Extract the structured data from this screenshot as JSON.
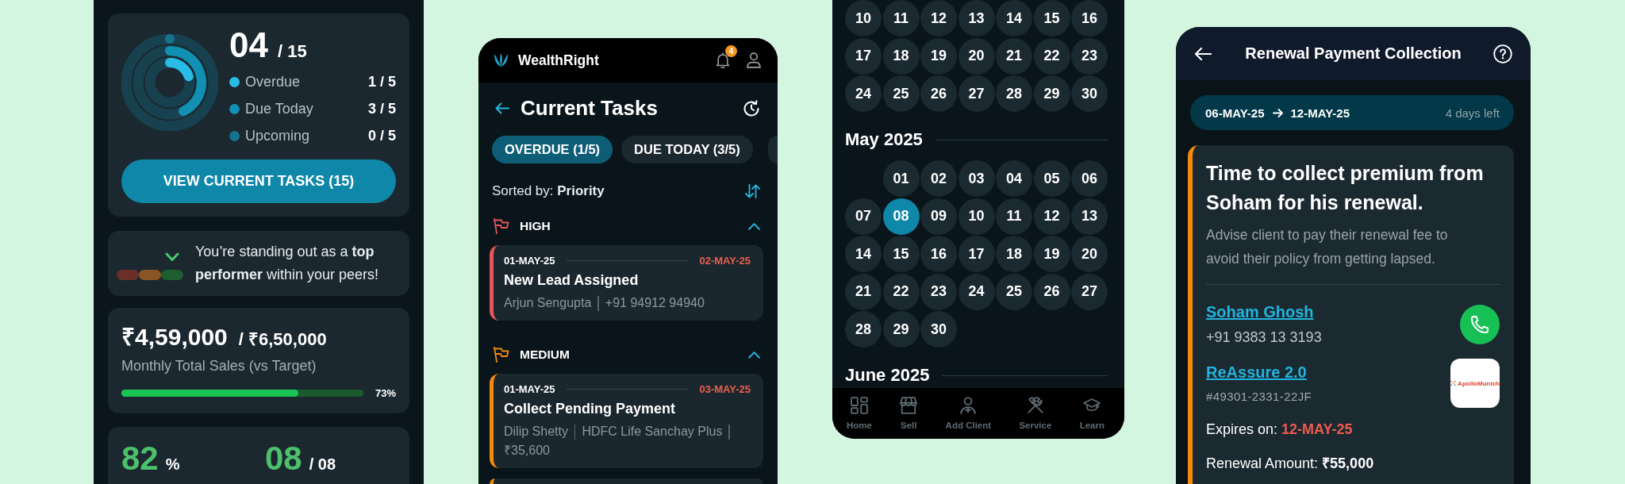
{
  "overview_panel": {
    "task_summary": {
      "done": "04",
      "total": "/ 15",
      "legend": [
        {
          "label": "Overdue",
          "value": "1 / 5",
          "color": "#29bce6"
        },
        {
          "label": "Due Today",
          "value": "3 / 5",
          "color": "#1190b4"
        },
        {
          "label": "Upcoming",
          "value": "0 / 5",
          "color": "#17728c"
        }
      ],
      "button": "VIEW CURRENT TASKS (15)"
    },
    "performance": {
      "segments": [
        {
          "color": "#6b2f28",
          "selected": false
        },
        {
          "color": "#8a5524",
          "selected": false
        },
        {
          "color": "#1c5e2d",
          "selected": true
        }
      ],
      "message": "You’re standing out as a **top performer** within your peers!"
    },
    "sales": {
      "achieved": "₹4,59,000",
      "target": "/ ₹6,50,000",
      "caption": "Monthly Total Sales (vs Target)",
      "level": 0.73,
      "percent": "73%"
    },
    "stats": [
      {
        "value": "82",
        "unit": "%"
      },
      {
        "value": "08",
        "unit": "/ 08"
      }
    ]
  },
  "tasks_screen": {
    "app_name": "WealthRight",
    "notification_count": "4",
    "title": "Current Tasks",
    "tabs": [
      {
        "label": "OVERDUE (1/5)",
        "selected": true
      },
      {
        "label": "DUE TODAY (3/5)",
        "selected": false
      }
    ],
    "sort": "Sorted by: **Priority**",
    "groups": [
      {
        "label": "HIGH",
        "color": "#e4565a",
        "expanded": true,
        "tasks": [
          {
            "start": "01-MAY-25",
            "due": "02-MAY-25",
            "title": "New Lead Assigned",
            "details": [
              "Arjun Sengupta",
              "+91 94912 94940"
            ]
          }
        ]
      },
      {
        "label": "MEDIUM",
        "color": "#f28a10",
        "expanded": true,
        "tasks": [
          {
            "start": "01-MAY-25",
            "due": "03-MAY-25",
            "title": "Collect Pending Payment",
            "details": [
              "Dilip Shetty",
              "HDFC Life Sanchay Plus",
              "₹35,600"
            ]
          }
        ]
      }
    ]
  },
  "calendar_screen": {
    "months": [
      {
        "weeks": [
          [
            {
              "label": "10",
              "selected": false
            },
            {
              "label": "11",
              "selected": false
            },
            {
              "label": "12",
              "selected": false
            },
            {
              "label": "13",
              "selected": false
            },
            {
              "label": "14",
              "selected": false
            },
            {
              "label": "15",
              "selected": false
            },
            {
              "label": "16",
              "selected": false
            }
          ],
          [
            {
              "label": "17",
              "selected": false
            },
            {
              "label": "18",
              "selected": false
            },
            {
              "label": "19",
              "selected": false
            },
            {
              "label": "20",
              "selected": false
            },
            {
              "label": "21",
              "selected": false
            },
            {
              "label": "22",
              "selected": false
            },
            {
              "label": "23",
              "selected": false
            }
          ],
          [
            {
              "label": "24",
              "selected": false
            },
            {
              "label": "25",
              "selected": false
            },
            {
              "label": "26",
              "selected": false
            },
            {
              "label": "27",
              "selected": false
            },
            {
              "label": "28",
              "selected": false
            },
            {
              "label": "29",
              "selected": false
            },
            {
              "label": "30",
              "selected": false
            }
          ]
        ]
      },
      {
        "title": "May 2025",
        "weeks": [
          [
            {
              "label": "01",
              "selected": false
            },
            {
              "label": "02",
              "selected": false
            },
            {
              "label": "03",
              "selected": false
            },
            {
              "label": "04",
              "selected": false
            },
            {
              "label": "05",
              "selected": false
            },
            {
              "label": "06",
              "selected": false
            }
          ],
          [
            {
              "label": "07",
              "selected": false
            },
            {
              "label": "08",
              "selected": true
            },
            {
              "label": "09",
              "selected": false
            },
            {
              "label": "10",
              "selected": false
            },
            {
              "label": "11",
              "selected": false
            },
            {
              "label": "12",
              "selected": false
            },
            {
              "label": "13",
              "selected": false
            }
          ],
          [
            {
              "label": "14",
              "selected": false
            },
            {
              "label": "15",
              "selected": false
            },
            {
              "label": "16",
              "selected": false
            },
            {
              "label": "17",
              "selected": false
            },
            {
              "label": "18",
              "selected": false
            },
            {
              "label": "19",
              "selected": false
            },
            {
              "label": "20",
              "selected": false
            }
          ],
          [
            {
              "label": "21",
              "selected": false
            },
            {
              "label": "22",
              "selected": false
            },
            {
              "label": "23",
              "selected": false
            },
            {
              "label": "24",
              "selected": false
            },
            {
              "label": "25",
              "selected": false
            },
            {
              "label": "26",
              "selected": false
            },
            {
              "label": "27",
              "selected": false
            }
          ],
          [
            {
              "label": "28",
              "selected": false
            },
            {
              "label": "29",
              "selected": false
            },
            {
              "label": "30",
              "selected": false
            }
          ]
        ]
      },
      {
        "title": "June 2025"
      }
    ],
    "nav": [
      "Home",
      "Sell",
      "Add Client",
      "Service",
      "Learn"
    ]
  },
  "renewal_screen": {
    "title": "Renewal Payment Collection",
    "period": {
      "start": "06-MAY-25",
      "end": "12-MAY-25",
      "remaining": "4 days left"
    },
    "heading": "Time to collect premium from Soham for his renewal.",
    "description": "Advise client to pay their renewal fee to avoid their policy from getting lapsed.",
    "client": {
      "name": "Soham Ghosh",
      "phone": "+91 9383 13 3193"
    },
    "policy": {
      "name": "ReAssure 2.0",
      "number": "#49301-2331-22JF",
      "insurer": "ApolloMunich"
    },
    "expiry": {
      "label": "Expires on:",
      "date": "12-MAY-25"
    },
    "amount": "Renewal Amount: **₹55,000**"
  }
}
